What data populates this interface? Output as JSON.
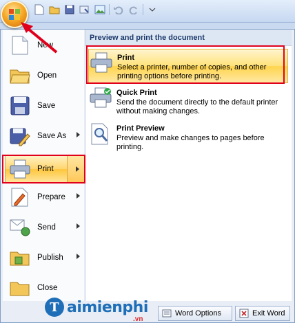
{
  "left_menu": {
    "items": [
      {
        "label": "New",
        "has_submenu": false
      },
      {
        "label": "Open",
        "has_submenu": false
      },
      {
        "label": "Save",
        "has_submenu": false
      },
      {
        "label": "Save As",
        "has_submenu": true
      },
      {
        "label": "Print",
        "has_submenu": true
      },
      {
        "label": "Prepare",
        "has_submenu": true
      },
      {
        "label": "Send",
        "has_submenu": true
      },
      {
        "label": "Publish",
        "has_submenu": true
      },
      {
        "label": "Close",
        "has_submenu": false
      }
    ]
  },
  "right_panel": {
    "header": "Preview and print the document",
    "items": [
      {
        "title": "Print",
        "description": "Select a printer, number of copies, and other printing options before printing."
      },
      {
        "title": "Quick Print",
        "description": "Send the document directly to the default printer without making changes."
      },
      {
        "title": "Print Preview",
        "description": "Preview and make changes to pages before printing."
      }
    ]
  },
  "bottom_bar": {
    "options_label": "Word Options",
    "exit_label": "Exit Word"
  },
  "watermark": {
    "text": "aimienphi",
    "sub": ".vn",
    "logo_letter": "T"
  },
  "colors": {
    "highlight": "#ffd56e",
    "annotation_red": "#e0001b",
    "header_text": "#1c3a6b"
  }
}
